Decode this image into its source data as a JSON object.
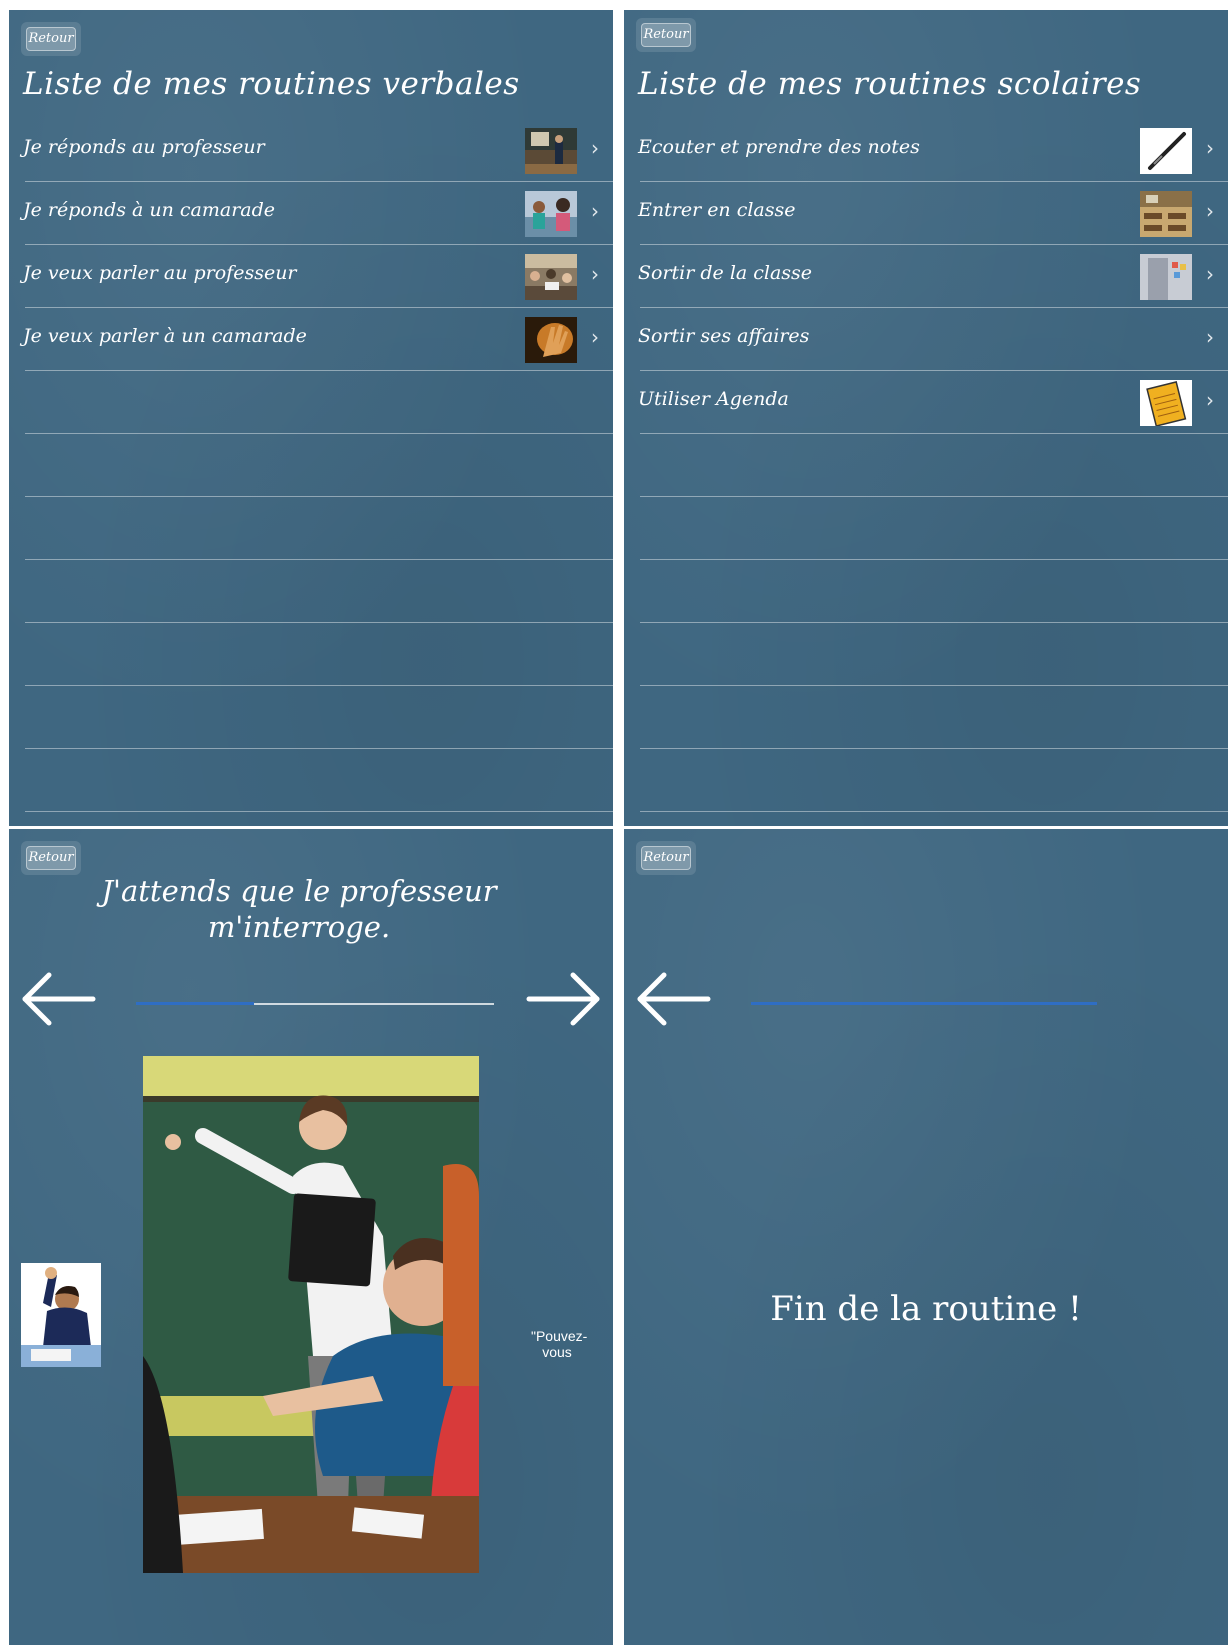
{
  "screens": {
    "verbales": {
      "back_label": "Retour",
      "title": "Liste de mes routines verbales",
      "items": [
        {
          "label": "Je réponds au professeur",
          "thumbnail": "teacher-at-board-photo"
        },
        {
          "label": "Je réponds à un camarade",
          "thumbnail": "students-talking-photo"
        },
        {
          "label": "Je veux parler au professeur",
          "thumbnail": "classroom-students-photo"
        },
        {
          "label": "Je veux parler à un camarade",
          "thumbnail": "raised-hand-photo"
        }
      ]
    },
    "scolaires": {
      "back_label": "Retour",
      "title": "Liste de mes routines scolaires",
      "items": [
        {
          "label": "Ecouter et prendre des notes",
          "thumbnail": "pen-image"
        },
        {
          "label": "Entrer en classe",
          "thumbnail": "classroom-desks-photo"
        },
        {
          "label": "Sortir de la classe",
          "thumbnail": "classroom-door-photo"
        },
        {
          "label": "Sortir ses affaires",
          "thumbnail": ""
        },
        {
          "label": "Utiliser Agenda",
          "thumbnail": "agenda-notebook-image"
        }
      ]
    },
    "step": {
      "back_label": "Retour",
      "instruction": "J'attends que le professeur m'interroge.",
      "progress": 0.33,
      "next_caption": "\"Pouvez-vous",
      "main_image": "teacher-writing-on-board-photo",
      "side_image": "student-raising-hand-photo"
    },
    "end": {
      "back_label": "Retour",
      "message": "Fin de la routine !",
      "progress": 1.0
    }
  },
  "colors": {
    "chalkboard": "#3f6781",
    "progress_fill": "#2f6ec4",
    "text": "#ffffff"
  }
}
